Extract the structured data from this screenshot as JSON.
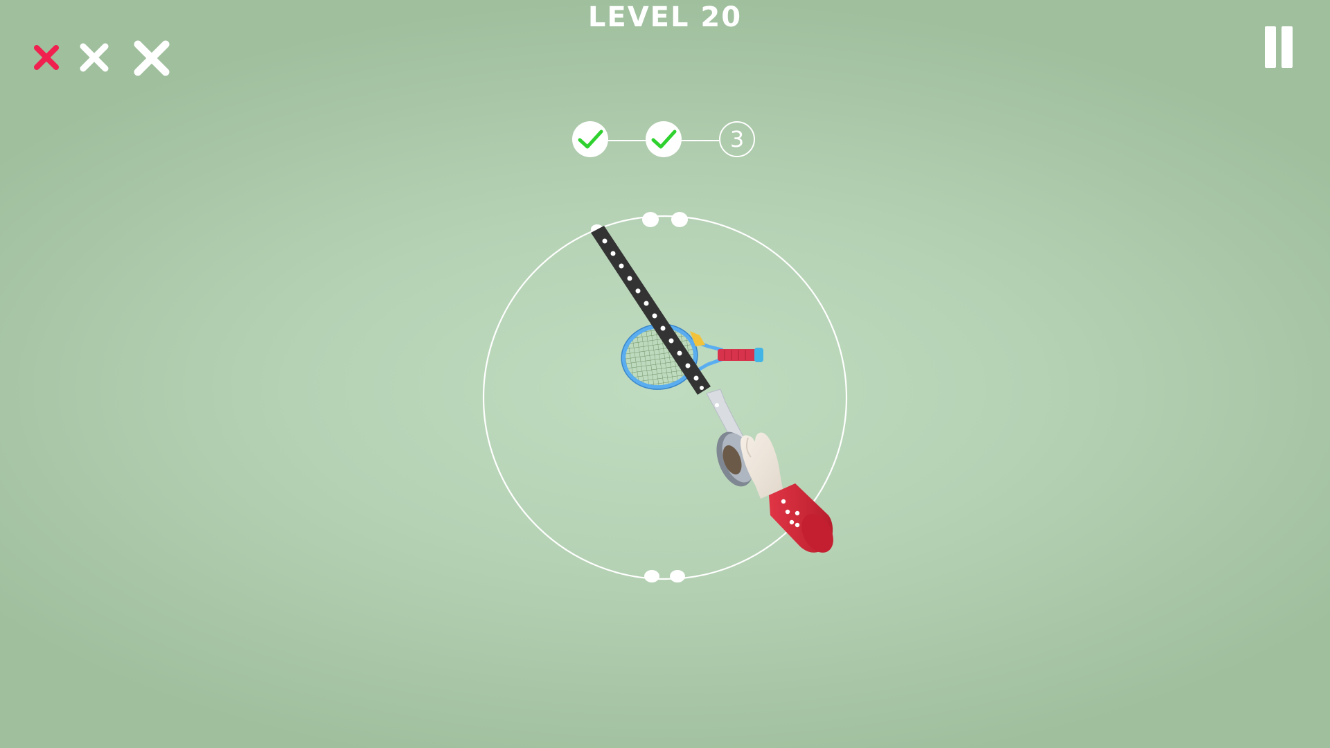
{
  "level": {
    "title": "LEVEL 20"
  },
  "strikes": {
    "used": 1,
    "total": 3,
    "used_color": "#f0204f",
    "remaining_color": "#ffffff",
    "icon": "x-mark-icon"
  },
  "progress": {
    "steps": [
      {
        "state": "complete",
        "icon": "check-icon"
      },
      {
        "state": "complete",
        "icon": "check-icon"
      },
      {
        "state": "current",
        "label": "3"
      }
    ],
    "check_color": "#2fd12f"
  },
  "pause": {
    "icon": "pause-icon"
  },
  "colors": {
    "tape": "#333333",
    "racket_frame": "#5aaef0",
    "racket_handle": "#d8334c",
    "sleeve": "#d62c3c"
  }
}
